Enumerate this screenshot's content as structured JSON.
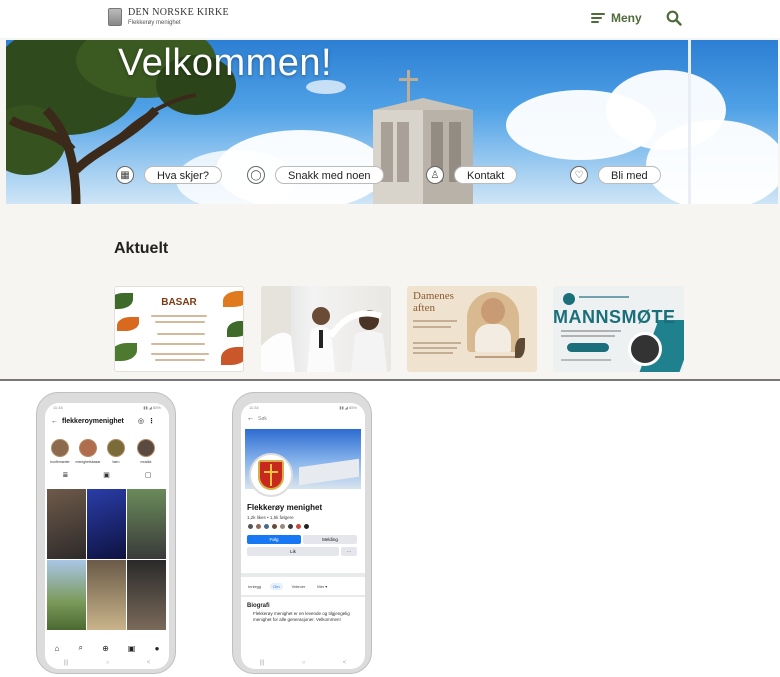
{
  "site": {
    "logo_title": "DEN NORSKE KIRKE",
    "logo_subtitle": "Flekkerøy menighet",
    "menu_label": "Meny",
    "hero_title": "Velkommen!",
    "chips": [
      {
        "icon": "calendar-icon",
        "label": "Hva skjer?"
      },
      {
        "icon": "chat-icon",
        "label": "Snakk med noen"
      },
      {
        "icon": "person-icon",
        "label": "Kontakt"
      },
      {
        "icon": "heart-icon",
        "label": "Bli med"
      }
    ],
    "section_title": "Aktuelt",
    "cards": [
      {
        "title": "BASAR"
      },
      {
        "title": ""
      },
      {
        "title": "Damenes aften"
      },
      {
        "title": "MANNSMØTE"
      }
    ]
  },
  "instagram": {
    "username": "flekkeroymenighet",
    "status_time": "11:34",
    "stories": [
      "konfirmanter",
      "menighetsbasar",
      "barn",
      "musikk"
    ]
  },
  "facebook": {
    "search_placeholder": "Søk",
    "page_name": "Flekkerøy menighet",
    "stats": "1,2k likes • 1,5k følgere",
    "follow_button": "Følg",
    "message_button": "Melding",
    "like_button": "Lik",
    "tabs": [
      "Innlegg",
      "Om",
      "Videoer",
      "Mer ▾"
    ],
    "bio_heading": "Biografi",
    "bio_text": "Flekkerøy menighet er en levende og tilgjengelig menighet for alle generasjoner. Velkommen!"
  },
  "colors": {
    "accent_green": "#4f6b3b",
    "fb_blue": "#1877f2",
    "mann_teal": "#1a6f7b"
  }
}
